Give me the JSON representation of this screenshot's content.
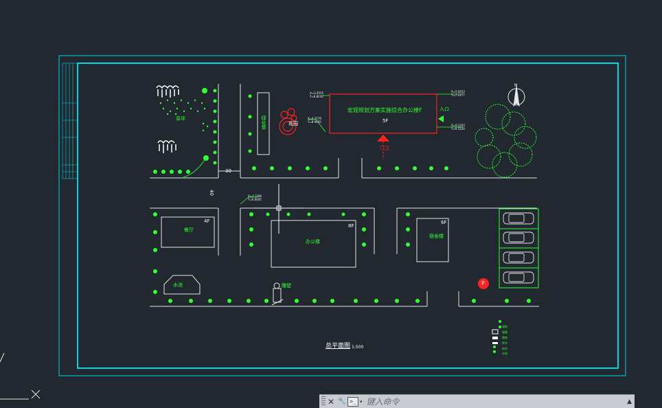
{
  "drawing": {
    "title_block": "宏观规划方案实施综合办公楼F",
    "building_floor": "5F",
    "labels": {
      "restaurant": "餐厅",
      "restaurant_floor": "4F",
      "office": "办公楼",
      "office_floor": "8F",
      "dorm": "宿舍楼",
      "dorm_floor": "6F",
      "garden": "花园",
      "lawn": "草坪",
      "pool": "水池",
      "sculpture": "雕塑",
      "guard": "门卫",
      "plan_title": "总平面图",
      "plan_scale": "1:500",
      "parking_marker": "P",
      "entrance_label": "入口",
      "side_strip": "绿化带",
      "road_width": "30",
      "road_width_v": "40",
      "north": "N"
    },
    "coords": [
      "X=3.3515 Y=6.8230",
      "X=4.2170 Y=8.9405",
      "X=5.0012 Y=7.1177",
      "X=6.3312 Y=9.5520",
      "X=2.1180 Y=6.0045"
    ],
    "legend": [
      "绿地",
      "道路",
      "建筑",
      "停车",
      "树木",
      "水体"
    ]
  },
  "command_line": {
    "close_label": "✕",
    "settings_label": "🔧",
    "prompt_label": ">_",
    "placeholder": "键入命令",
    "expand_label": "▲"
  },
  "colors": {
    "background": "#212830",
    "frame": "#00d8e0",
    "green": "#33ff33",
    "white": "#ffffff",
    "red": "#ff2020"
  }
}
